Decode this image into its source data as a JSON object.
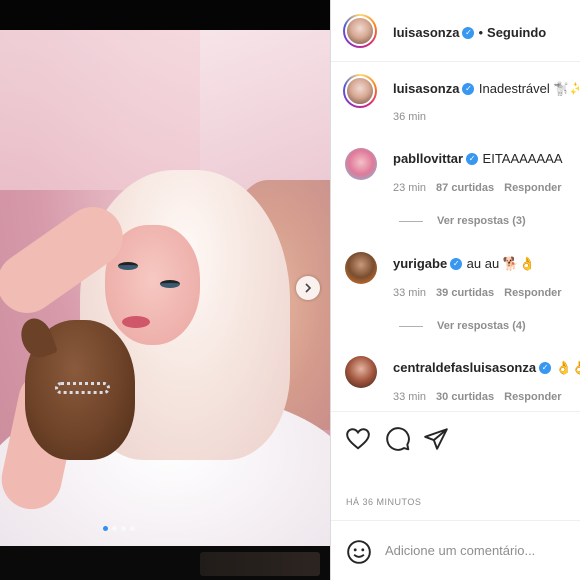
{
  "post": {
    "author": "luisasonza",
    "follow_status": "Seguindo",
    "caption": "Inadestrável 🐩✨",
    "caption_time": "36 min",
    "posted_ago": "HÁ 36 MINUTOS"
  },
  "comments": [
    {
      "user": "pabllovittar",
      "text": "EITAAAAAAA",
      "time": "23 min",
      "likes": "87 curtidas",
      "reply_label": "Responder",
      "view_replies": "Ver respostas (3)"
    },
    {
      "user": "yurigabe",
      "text": "au au 🐕👌",
      "time": "33 min",
      "likes": "39 curtidas",
      "reply_label": "Responder",
      "view_replies": "Ver respostas (4)"
    },
    {
      "user": "centraldefasluisasonza",
      "text": "👌👌",
      "time": "33 min",
      "likes": "30 curtidas",
      "reply_label": "Responder"
    }
  ],
  "comment_box": {
    "placeholder": "Adicione um comentário..."
  },
  "carousel": {
    "count": 4,
    "active": 1
  },
  "icons": {
    "like": "heart-icon",
    "comment": "comment-icon",
    "share": "send-icon",
    "emoji": "emoji-icon",
    "next": "chevron-right-icon"
  },
  "colors": {
    "verified": "#3897f0",
    "active_dot": "#2f8ff0"
  }
}
